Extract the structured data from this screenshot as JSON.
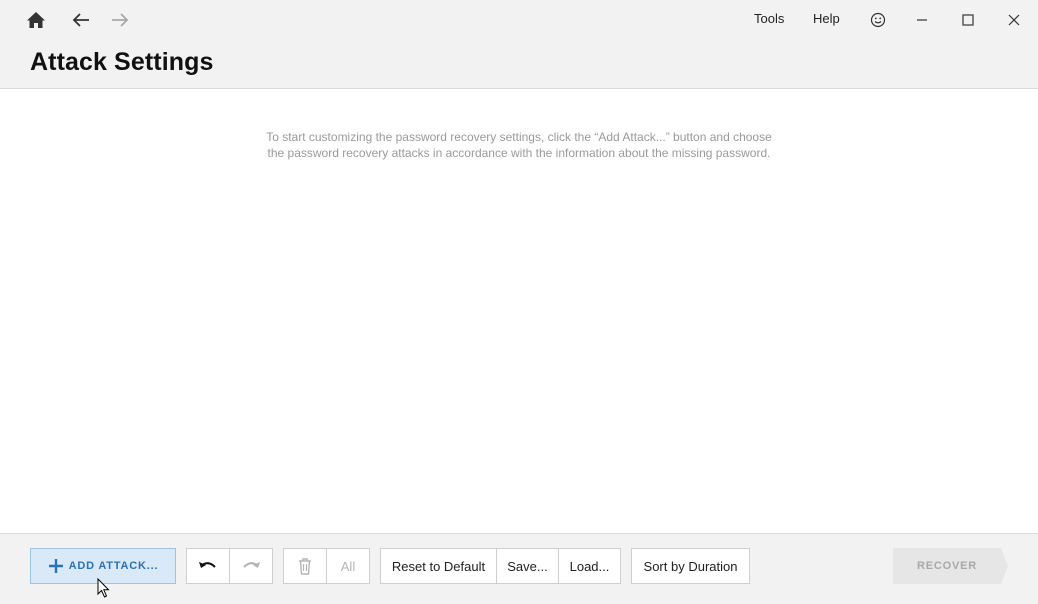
{
  "titlebar": {
    "icons": [
      "home-icon",
      "back-arrow-icon",
      "forward-arrow-icon"
    ],
    "menu": {
      "tools": "Tools",
      "help": "Help"
    },
    "window_icons": [
      "smiley-icon",
      "minimize-icon",
      "maximize-icon",
      "close-icon"
    ]
  },
  "page": {
    "title": "Attack Settings"
  },
  "content": {
    "hint": "To start customizing the password recovery settings, click the “Add Attack...” button and choose the password recovery attacks in accordance with the information about the missing password."
  },
  "toolbar": {
    "add_attack": "ADD ATTACK...",
    "delete_all": "All",
    "reset": "Reset to Default",
    "save": "Save...",
    "load": "Load...",
    "sort": "Sort by Duration",
    "recover": "RECOVER"
  },
  "colors": {
    "accent": "#2a72b8",
    "accent_bg": "#d9e9f8",
    "disabled": "#b5b5b5",
    "recover_bg": "#e6e6e6"
  }
}
